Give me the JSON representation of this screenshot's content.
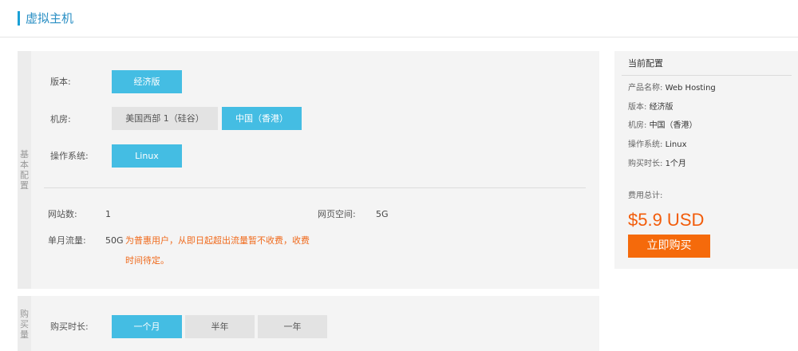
{
  "header": {
    "title": "虚拟主机"
  },
  "basic": {
    "side_label": [
      "基",
      "本",
      "配",
      "置"
    ],
    "version": {
      "label": "版本:",
      "options": [
        "经济版"
      ]
    },
    "datacenter": {
      "label": "机房:",
      "options": [
        "美国西部 1（硅谷）",
        "中国（香港）"
      ]
    },
    "os": {
      "label": "操作系统:",
      "options": [
        "Linux"
      ]
    },
    "sites": {
      "label": "网站数:",
      "value": "1"
    },
    "space": {
      "label": "网页空间:",
      "value": "5G"
    },
    "traffic": {
      "label": "单月流量:",
      "value": "50G",
      "notice": "为普惠用户，从即日起超出流量暂不收费，收费时间待定。"
    }
  },
  "purchase": {
    "side_label": [
      "购",
      "买",
      "量"
    ],
    "duration": {
      "label": "购买时长:",
      "options": [
        "一个月",
        "半年",
        "一年"
      ]
    }
  },
  "summary": {
    "title": "当前配置",
    "rows": [
      {
        "key": "产品名称:",
        "value": "Web Hosting"
      },
      {
        "key": "版本:",
        "value": "经济版"
      },
      {
        "key": "机房:",
        "value": "中国（香港）"
      },
      {
        "key": "操作系统:",
        "value": "Linux"
      },
      {
        "key": "购买时长:",
        "value": "1个月"
      }
    ],
    "total_label": "费用总计:",
    "price": "$5.9 USD",
    "buy_label": "立即购买"
  },
  "colors": {
    "accent": "#44bde3",
    "price": "#f25c0a",
    "buy_button": "#f56a0b",
    "notice": "#f06a1c",
    "title": "#2a8fc4"
  }
}
